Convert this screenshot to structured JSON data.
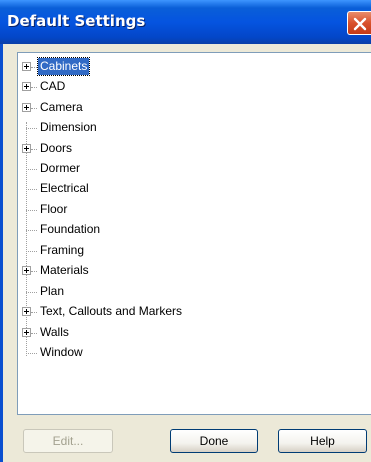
{
  "window": {
    "title": "Default Settings",
    "close_icon": "close-icon",
    "close_color": "#d9502b",
    "title_bar_color": "#0554e0"
  },
  "tree": {
    "items": [
      {
        "label": "Cabinets",
        "expandable": true,
        "selected": true
      },
      {
        "label": "CAD",
        "expandable": true,
        "selected": false
      },
      {
        "label": "Camera",
        "expandable": true,
        "selected": false
      },
      {
        "label": "Dimension",
        "expandable": false,
        "selected": false
      },
      {
        "label": "Doors",
        "expandable": true,
        "selected": false
      },
      {
        "label": "Dormer",
        "expandable": false,
        "selected": false
      },
      {
        "label": "Electrical",
        "expandable": false,
        "selected": false
      },
      {
        "label": "Floor",
        "expandable": false,
        "selected": false
      },
      {
        "label": "Foundation",
        "expandable": false,
        "selected": false
      },
      {
        "label": "Framing",
        "expandable": false,
        "selected": false
      },
      {
        "label": "Materials",
        "expandable": true,
        "selected": false
      },
      {
        "label": "Plan",
        "expandable": false,
        "selected": false
      },
      {
        "label": "Text, Callouts and Markers",
        "expandable": true,
        "selected": false
      },
      {
        "label": "Walls",
        "expandable": true,
        "selected": false
      },
      {
        "label": "Window",
        "expandable": false,
        "selected": false
      }
    ]
  },
  "buttons": {
    "edit": "Edit...",
    "done": "Done",
    "help": "Help"
  }
}
